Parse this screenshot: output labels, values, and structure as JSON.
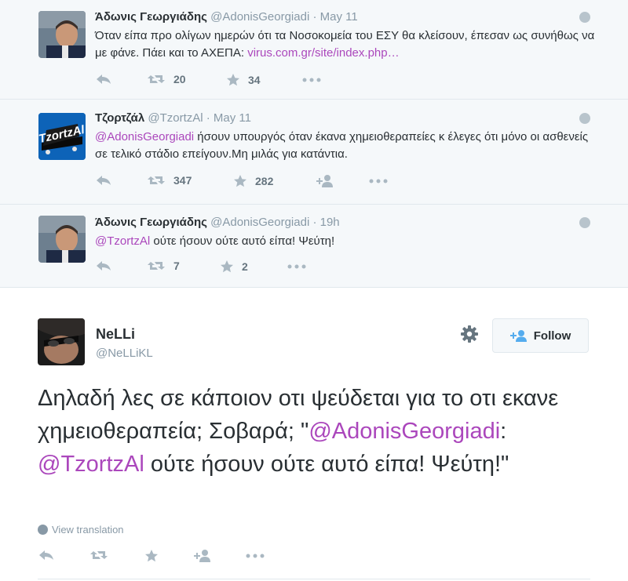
{
  "tweets": [
    {
      "name": "Άδωνις Γεωργιάδης",
      "handle": "@AdonisGeorgiadi",
      "sep": "·",
      "date": "May 11",
      "text": "Όταν είπα προ ολίγων ημερών ότι τα Νοσοκομεία του ΕΣΥ θα κλείσουν, έπεσαν ως συνήθως να με φάνε. Πάει και το ΑΧΕΠΑ: ",
      "link": "virus.com.gr/site/index.php…",
      "retweets": "20",
      "favorites": "34"
    },
    {
      "name": "Τζορτζάλ",
      "handle": "@TzortzAl",
      "sep": "·",
      "date": "May 11",
      "mention": "@AdonisGeorgiadi",
      "text": " ήσουν υπουργός όταν έκανα χημειοθεραπείες κ έλεγες ότι μόνο οι ασθενείς σε τελικό στάδιο επείγουν.Μη μιλάς για κατάντια.",
      "retweets": "347",
      "favorites": "282",
      "avatar_text": "TzortzAl"
    },
    {
      "name": "Άδωνις Γεωργιάδης",
      "handle": "@AdonisGeorgiadi",
      "sep": "·",
      "date": "19h",
      "mention": "@TzortzAl",
      "text": " ούτε ήσουν ούτε αυτό είπα! Ψεύτη!",
      "retweets": "7",
      "favorites": "2"
    }
  ],
  "main": {
    "name": "NeLLi",
    "handle": "@NeLLiKL",
    "follow_label": "Follow",
    "text_part1": "Δηλαδή λες σε κάποιον οτι ψεύδεται για το οτι εκανε χημειοθεραπεία; Σοβαρά; \"",
    "mention1": "@AdonisGeorgiadi",
    "text_part2": ": ",
    "mention2": "@TzortzAl",
    "text_part3": " ούτε ήσουν ούτε αυτό είπα! Ψεύτη!\"",
    "view_translation": "View translation"
  },
  "colors": {
    "link": "#ab47bc",
    "thread_bg": "#f5f8fa",
    "action_icon": "#aab8c2"
  }
}
